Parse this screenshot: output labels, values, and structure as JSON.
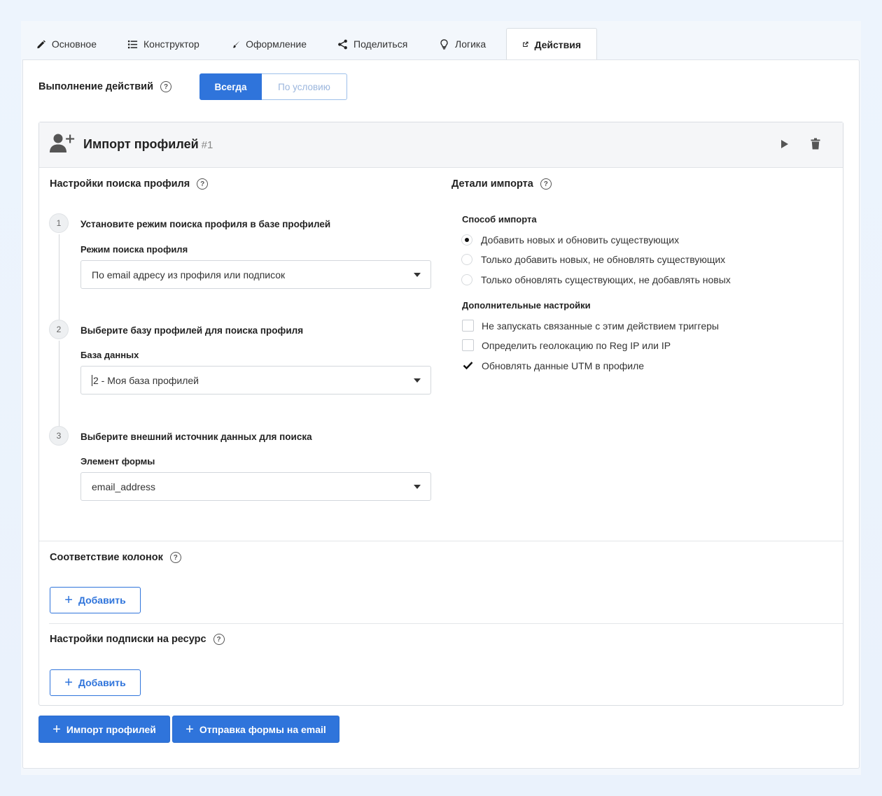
{
  "tabs": [
    {
      "label": "Основное",
      "icon": "pencil-icon"
    },
    {
      "label": "Конструктор",
      "icon": "list-icon"
    },
    {
      "label": "Оформление",
      "icon": "brush-icon"
    },
    {
      "label": "Поделиться",
      "icon": "share-icon"
    },
    {
      "label": "Логика",
      "icon": "lightbulb-icon"
    },
    {
      "label": "Действия",
      "icon": "external-link-icon",
      "active": true
    }
  ],
  "execution": {
    "label": "Выполнение действий",
    "help": "?",
    "options": [
      "Всегда",
      "По условию"
    ],
    "selected": "Всегда"
  },
  "action_card": {
    "title": "Импорт профилей",
    "number": "#1",
    "search_settings": {
      "title": "Настройки поиска профиля",
      "steps": [
        {
          "num": "1",
          "title": "Установите режим поиска профиля в базе профилей",
          "field_label": "Режим поиска профиля",
          "value": "По email адресу из профиля или подписок"
        },
        {
          "num": "2",
          "title": "Выберите базу профилей для поиска профиля",
          "field_label": "База данных",
          "value": "2 - Моя база профилей"
        },
        {
          "num": "3",
          "title": "Выберите внешний источник данных для поиска",
          "field_label": "Элемент формы",
          "value": "email_address"
        }
      ]
    },
    "import_details": {
      "title": "Детали импорта",
      "method_label": "Способ импорта",
      "methods": [
        {
          "label": "Добавить новых и обновить существующих",
          "selected": true
        },
        {
          "label": "Только добавить новых, не обновлять существующих",
          "selected": false
        },
        {
          "label": "Только обновлять существующих, не добавлять новых",
          "selected": false
        }
      ],
      "extra_label": "Дополнительные настройки",
      "extras": [
        {
          "label": "Не запускать связанные с этим действием триггеры",
          "checked": false
        },
        {
          "label": "Определить геолокацию по Reg IP или IP",
          "checked": false
        },
        {
          "label": "Обновлять данные UTM в профиле",
          "checked": true
        }
      ]
    },
    "column_mapping": {
      "title": "Соответствие колонок",
      "add_label": "Добавить"
    },
    "subscription": {
      "title": "Настройки подписки на ресурс",
      "add_label": "Добавить"
    }
  },
  "footer_buttons": [
    "Импорт профилей",
    "Отправка формы на email"
  ],
  "colors": {
    "accent": "#2f74db",
    "background": "#edf4fd"
  }
}
